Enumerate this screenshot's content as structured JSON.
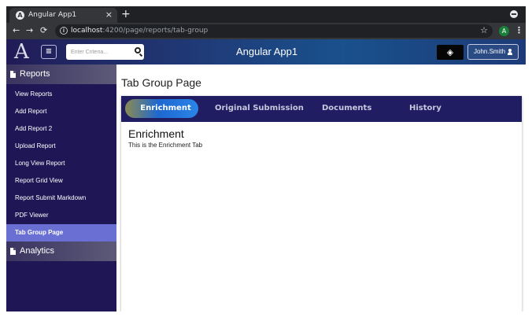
{
  "browser": {
    "tab_title": "Angular App1",
    "favicon_letter": "A",
    "close_glyph": "×",
    "new_tab_glyph": "+",
    "url_host": "localhost",
    "url_path": ":4200/page/reports/tab-group",
    "profile_initial": "A",
    "menu_glyph": "⋮",
    "star_glyph": "☆",
    "info_glyph": "i",
    "back_glyph": "←",
    "forward_glyph": "→",
    "reload_glyph": "⟳"
  },
  "header": {
    "logo_text": "A",
    "menu_glyph": "≡",
    "search_placeholder": "Enter Criteria...",
    "title": "Angular App1",
    "theme_glyph": "◈",
    "user_name": "John.Smith"
  },
  "sidebar": {
    "reports_label": "Reports",
    "items": [
      {
        "label": "View Reports"
      },
      {
        "label": "Add Report"
      },
      {
        "label": "Add Report 2"
      },
      {
        "label": "Upload Report"
      },
      {
        "label": "Long View Report"
      },
      {
        "label": "Report Grid View"
      },
      {
        "label": "Report Submit Markdown"
      },
      {
        "label": "PDF Viewer"
      },
      {
        "label": "Tab Group Page",
        "active": true
      }
    ],
    "analytics_label": "Analytics"
  },
  "main": {
    "page_title": "Tab Group Page",
    "tabs": [
      {
        "label": "Enrichment",
        "active": true
      },
      {
        "label": "Original Submission"
      },
      {
        "label": "Documents"
      },
      {
        "label": "History"
      }
    ],
    "content_title": "Enrichment",
    "content_body": "This is the Enrichment Tab"
  }
}
